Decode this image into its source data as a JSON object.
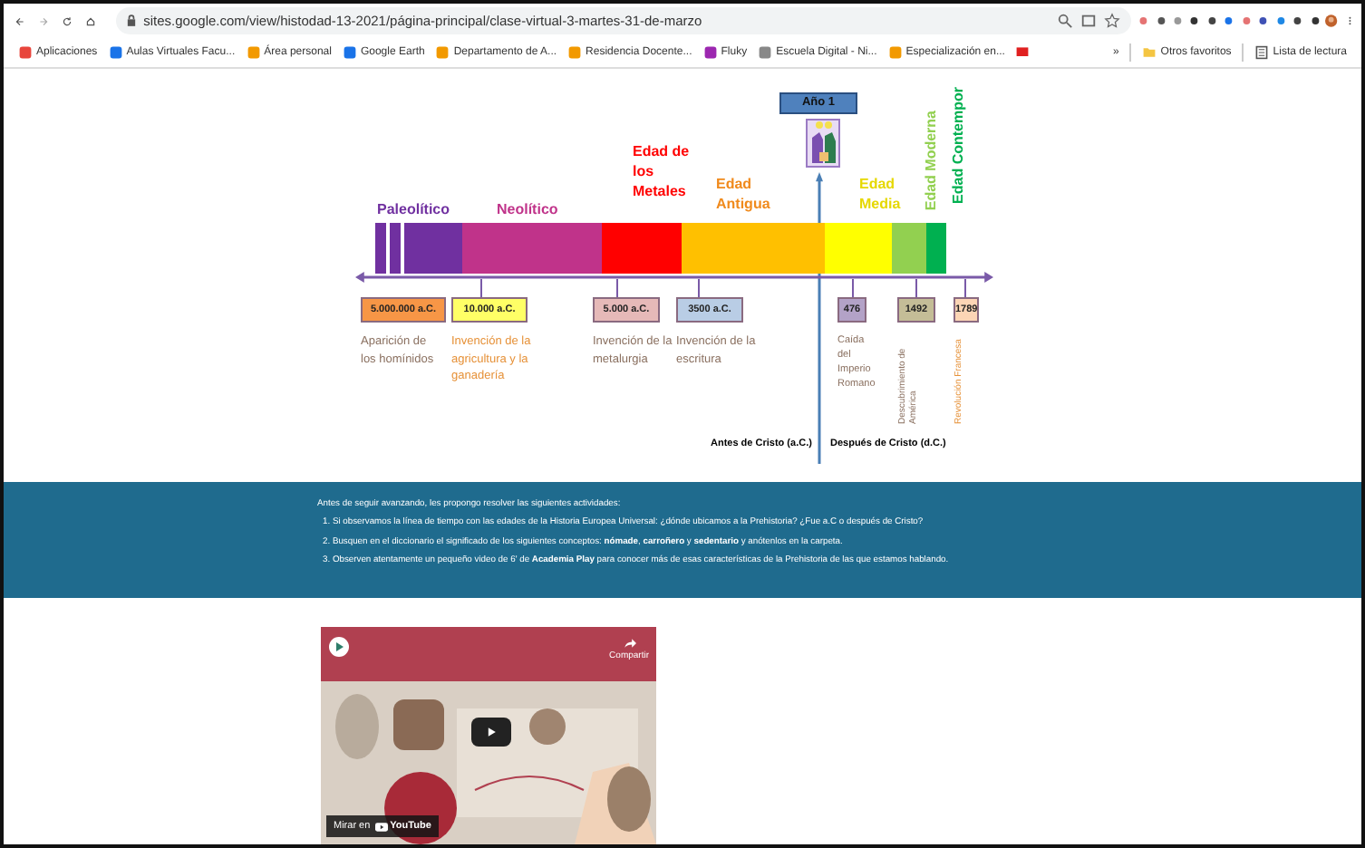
{
  "browser": {
    "url": "sites.google.com/view/histodad-13-2021/página-principal/clase-virtual-3-martes-31-de-marzo",
    "bookmarks": [
      "Aplicaciones",
      "Aulas Virtuales Facu...",
      "Área personal",
      "Google Earth",
      "Departamento de A...",
      "Residencia Docente...",
      "Fluky",
      "Escuela Digital - Ni...",
      "Especialización en..."
    ],
    "more": "»",
    "other_bookmarks": "Otros favoritos",
    "reading_list": "Lista de lectura"
  },
  "timeline": {
    "year_one": "Año 1",
    "eras": [
      {
        "label": "Paleolítico",
        "color": "#7030a0",
        "kind": "horizontal"
      },
      {
        "label": "Neolítico",
        "color": "#c0338a",
        "kind": "horizontal"
      },
      {
        "label": "Edad de los Metales",
        "color": "#ff0000",
        "kind": "horizontal"
      },
      {
        "label": "Edad Antigua",
        "color": "#ffc000",
        "kind": "horizontal"
      },
      {
        "label": "Edad Media",
        "color": "#ffff00",
        "kind": "horizontal"
      },
      {
        "label": "Edad Moderna",
        "color": "#92d050",
        "kind": "vertical"
      },
      {
        "label": "Edad Contempor",
        "color": "#00b050",
        "kind": "vertical"
      }
    ],
    "markers": [
      {
        "date": "5.000.000 a.C.",
        "description": "Aparición de los homínidos",
        "color": "#f79646",
        "kind": "horizontal"
      },
      {
        "date": "10.000 a.C.",
        "description": "Invención de la agricultura y la ganadería",
        "color": "#ffff66",
        "kind": "horizontal"
      },
      {
        "date": "5.000 a.C.",
        "description": "Invención de la metalurgia",
        "color": "#e6b9b8",
        "kind": "horizontal"
      },
      {
        "date": "3500 a.C.",
        "description": "Invención de la escritura",
        "color": "#b9cde5",
        "kind": "horizontal"
      },
      {
        "date": "476",
        "description": "Caída del Imperio Romano",
        "color": "#b3a2c7",
        "kind": "horizontal"
      },
      {
        "date": "1492",
        "description": "Descubrimiento de América",
        "color": "#c4bd97",
        "kind": "vertical"
      },
      {
        "date": "1789",
        "description": "Revolución Francesa",
        "color": "#fcd5b5",
        "kind": "vertical"
      }
    ],
    "before": "Antes de Cristo (a.C.)",
    "after": "Después de Cristo (d.C.)"
  },
  "activities": {
    "intro": "Antes de seguir avanzando, les propongo resolver las siguientes actividades:",
    "items": [
      "1. Si observamos la línea de tiempo con las edades de la Historia Europea Universal: ¿dónde ubicamos a la Prehistoria? ¿Fue a.C o después de Cristo?",
      "2. Busquen en el diccionario el significado de los siguientes conceptos: **nómade**, **carroñero** y **sedentario** y anótenlos en la carpeta.",
      "3. Observen atentamente un pequeño video de 6' de **Academia Play** para conocer más de esas características de la Prehistoria de las que estamos hablando."
    ]
  },
  "video": {
    "share": "Compartir",
    "watch_on": "Mirar en",
    "platform": "YouTube"
  }
}
